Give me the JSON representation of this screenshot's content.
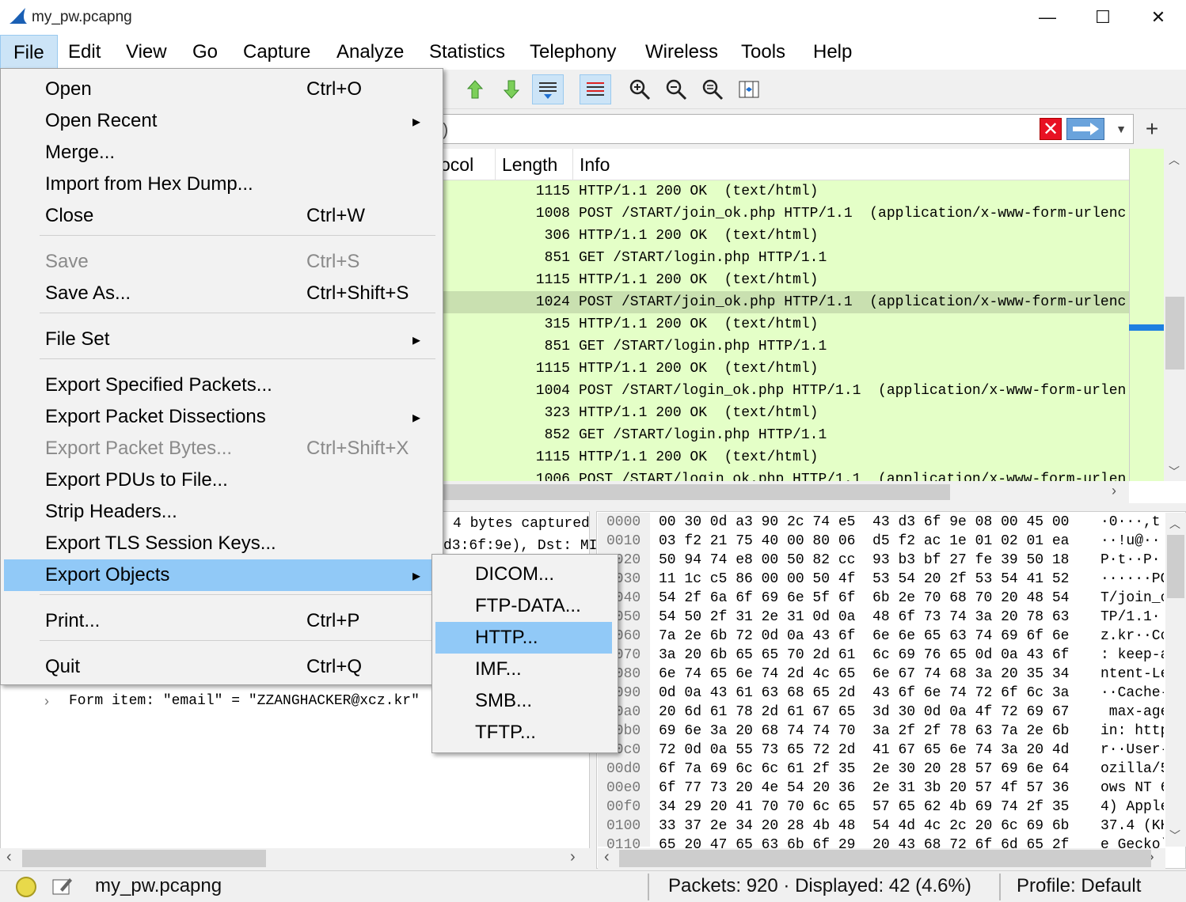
{
  "window": {
    "title": "my_pw.pcapng",
    "minimize_glyph": "—",
    "maximize_glyph": "☐",
    "close_glyph": "✕"
  },
  "menubar": [
    "File",
    "Edit",
    "View",
    "Go",
    "Capture",
    "Analyze",
    "Statistics",
    "Telephony",
    "Wireless",
    "Tools",
    "Help"
  ],
  "toolbar": {
    "icons": [
      "go-first-icon",
      "go-last-icon",
      "autoscroll-icon",
      "colorize-icon",
      "zoom-in-icon",
      "zoom-out-icon",
      "zoom-reset-icon",
      "resize-columns-icon"
    ]
  },
  "filter": {
    "visible_text": ")",
    "clear_glyph": "✕",
    "add_glyph": "+"
  },
  "packet_list": {
    "columns": [
      "ocol",
      "Length",
      "Info"
    ],
    "rows": [
      {
        "length": "1115",
        "info": "HTTP/1.1 200 OK  (text/html)"
      },
      {
        "length": "1008",
        "info": "POST /START/join_ok.php HTTP/1.1  (application/x-www-form-urlenc"
      },
      {
        "length": "306",
        "info": "HTTP/1.1 200 OK  (text/html)"
      },
      {
        "length": "851",
        "info": "GET /START/login.php HTTP/1.1"
      },
      {
        "length": "1115",
        "info": "HTTP/1.1 200 OK  (text/html)"
      },
      {
        "length": "1024",
        "info": "POST /START/join_ok.php HTTP/1.1  (application/x-www-form-urlenc"
      },
      {
        "length": "315",
        "info": "HTTP/1.1 200 OK  (text/html)"
      },
      {
        "length": "851",
        "info": "GET /START/login.php HTTP/1.1"
      },
      {
        "length": "1115",
        "info": "HTTP/1.1 200 OK  (text/html)"
      },
      {
        "length": "1004",
        "info": "POST /START/login_ok.php HTTP/1.1  (application/x-www-form-urlen"
      },
      {
        "length": "323",
        "info": "HTTP/1.1 200 OK  (text/html)"
      },
      {
        "length": "852",
        "info": "GET /START/login.php HTTP/1.1"
      },
      {
        "length": "1115",
        "info": "HTTP/1.1 200 OK  (text/html)"
      },
      {
        "length": "1006",
        "info": "POST /START/login_ok.php HTTP/1.1  (application/x-www-form-urlen"
      }
    ],
    "selected_row": 5
  },
  "details": {
    "line1": "4 bytes captured",
    "line2": "d3:6f:9e), Dst: MI",
    "form_item": "Form item: \"email\" = \"ZZANGHACKER@xcz.kr\""
  },
  "bytes": {
    "rows": [
      {
        "off": "0000",
        "hex": "00 30 0d a3 90 2c 74 e5  43 d3 6f 9e 08 00 45 00",
        "ascii": "·0···,t"
      },
      {
        "off": "0010",
        "hex": "03 f2 21 75 40 00 80 06  d5 f2 ac 1e 01 02 01 ea",
        "ascii": "··!u@··"
      },
      {
        "off": "0020",
        "hex": "50 94 74 e8 00 50 82 cc  93 b3 bf 27 fe 39 50 18",
        "ascii": "P·t··P·"
      },
      {
        "off": "0030",
        "hex": "11 1c c5 86 00 00 50 4f  53 54 20 2f 53 54 41 52",
        "ascii": "······PO"
      },
      {
        "off": "0040",
        "hex": "54 2f 6a 6f 69 6e 5f 6f  6b 2e 70 68 70 20 48 54",
        "ascii": "T/join_o"
      },
      {
        "off": "0050",
        "hex": "54 50 2f 31 2e 31 0d 0a  48 6f 73 74 3a 20 78 63",
        "ascii": "TP/1.1··"
      },
      {
        "off": "0060",
        "hex": "7a 2e 6b 72 0d 0a 43 6f  6e 6e 65 63 74 69 6f 6e",
        "ascii": "z.kr··Co"
      },
      {
        "off": "0070",
        "hex": "3a 20 6b 65 65 70 2d 61  6c 69 76 65 0d 0a 43 6f",
        "ascii": ": keep-a"
      },
      {
        "off": "0080",
        "hex": "6e 74 65 6e 74 2d 4c 65  6e 67 74 68 3a 20 35 34",
        "ascii": "ntent-Le"
      },
      {
        "off": "0090",
        "hex": "0d 0a 43 61 63 68 65 2d  43 6f 6e 74 72 6f 6c 3a",
        "ascii": "··Cache-"
      },
      {
        "off": "00a0",
        "hex": "20 6d 61 78 2d 61 67 65  3d 30 0d 0a 4f 72 69 67",
        "ascii": " max-age"
      },
      {
        "off": "00b0",
        "hex": "69 6e 3a 20 68 74 74 70  3a 2f 2f 78 63 7a 2e 6b",
        "ascii": "in: http"
      },
      {
        "off": "00c0",
        "hex": "72 0d 0a 55 73 65 72 2d  41 67 65 6e 74 3a 20 4d",
        "ascii": "r··User-"
      },
      {
        "off": "00d0",
        "hex": "6f 7a 69 6c 6c 61 2f 35  2e 30 20 28 57 69 6e 64",
        "ascii": "ozilla/5"
      },
      {
        "off": "00e0",
        "hex": "6f 77 73 20 4e 54 20 36  2e 31 3b 20 57 4f 57 36",
        "ascii": "ows NT 6"
      },
      {
        "off": "00f0",
        "hex": "34 29 20 41 70 70 6c 65  57 65 62 4b 69 74 2f 35",
        "ascii": "4) Apple"
      },
      {
        "off": "0100",
        "hex": "33 37 2e 34 20 28 4b 48  54 4d 4c 2c 20 6c 69 6b",
        "ascii": "37.4 (KH"
      },
      {
        "off": "0110",
        "hex": "65 20 47 65 63 6b 6f 29  20 43 68 72 6f 6d 65 2f",
        "ascii": "e Gecko)"
      }
    ]
  },
  "status": {
    "file": "my_pw.pcapng",
    "packets": "Packets: 920 · Displayed: 42 (4.6%)",
    "profile": "Profile: Default"
  },
  "file_menu": {
    "items": [
      {
        "label": "Open",
        "accel": "Ctrl+O"
      },
      {
        "label": "Open Recent",
        "submenu": true
      },
      {
        "label": "Merge..."
      },
      {
        "label": "Import from Hex Dump..."
      },
      {
        "label": "Close",
        "accel": "Ctrl+W"
      },
      {
        "label": "Save",
        "accel": "Ctrl+S",
        "disabled": true
      },
      {
        "label": "Save As...",
        "accel": "Ctrl+Shift+S"
      },
      {
        "label": "File Set",
        "submenu": true
      },
      {
        "label": "Export Specified Packets..."
      },
      {
        "label": "Export Packet Dissections",
        "submenu": true
      },
      {
        "label": "Export Packet Bytes...",
        "accel": "Ctrl+Shift+X",
        "disabled": true
      },
      {
        "label": "Export PDUs to File..."
      },
      {
        "label": "Strip Headers..."
      },
      {
        "label": "Export TLS Session Keys..."
      },
      {
        "label": "Export Objects",
        "submenu": true,
        "highlighted": true
      },
      {
        "label": "Print...",
        "accel": "Ctrl+P"
      },
      {
        "label": "Quit",
        "accel": "Ctrl+Q"
      }
    ]
  },
  "export_objects_submenu": {
    "items": [
      "DICOM...",
      "FTP-DATA...",
      "HTTP...",
      "IMF...",
      "SMB...",
      "TFTP..."
    ],
    "highlighted": "HTTP..."
  }
}
